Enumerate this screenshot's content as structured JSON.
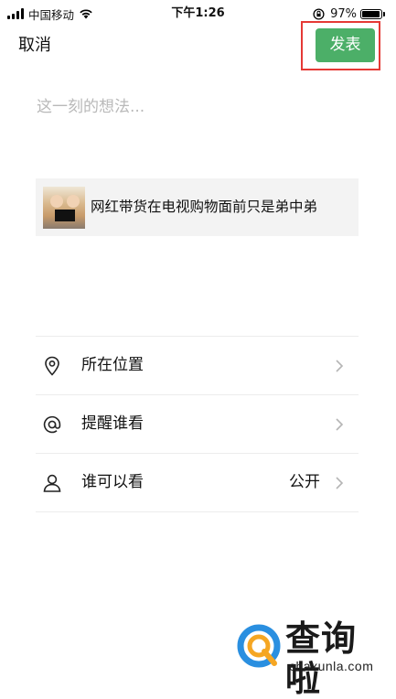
{
  "status_bar": {
    "carrier": "中国移动",
    "time": "下午1:26",
    "battery_percent": "97%",
    "battery_level": 0.97
  },
  "header": {
    "cancel_label": "取消",
    "publish_label": "发表"
  },
  "composer": {
    "placeholder": "这一刻的想法..."
  },
  "link_card": {
    "title": "网红带货在电视购物面前只是弟中弟"
  },
  "options": [
    {
      "label": "所在位置",
      "icon": "location-pin-icon",
      "value": ""
    },
    {
      "label": "提醒谁看",
      "icon": "at-sign-icon",
      "value": ""
    },
    {
      "label": "谁可以看",
      "icon": "person-icon",
      "value": "公开"
    }
  ],
  "watermark": {
    "text": "查询啦",
    "domain": "chaxunla.com"
  },
  "colors": {
    "publish_green": "#4caf68",
    "highlight_red": "#e53935",
    "placeholder_gray": "#b9b9b9",
    "card_bg": "#f3f3f3"
  }
}
